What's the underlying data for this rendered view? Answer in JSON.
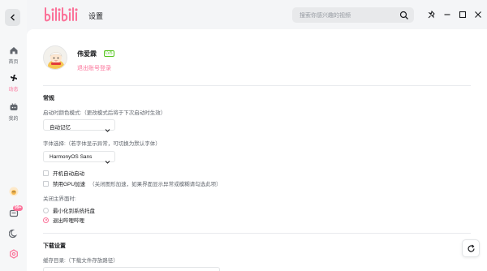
{
  "nav": {
    "home": "首页",
    "dynamic": "动态",
    "mine": "我的",
    "badge": "99+"
  },
  "header": {
    "title": "设置",
    "search_placeholder": "搜索你感兴趣的视频"
  },
  "user": {
    "name": "伟爱霖",
    "level": "LV5",
    "logout": "退出账号登录"
  },
  "general": {
    "title": "常规",
    "color_mode_label": "启动时颜色模式:（更改模式后将于下次启动时生效）",
    "color_mode_value": "自动记忆",
    "font_label": "字体选择:（若字体显示异常，可切换为默认字体）",
    "font_value": "HarmonyOS Sans",
    "autostart": "开机自动启动",
    "gpu_label": "禁用GPU加速",
    "gpu_hint": "（关闭图形加速，如果界面显示异常或模糊请勾选此项）",
    "close_label": "关闭主界面时:",
    "close_options": [
      "最小化到系统托盘",
      "退出哔哩哔哩"
    ]
  },
  "download": {
    "title": "下载设置",
    "cache_label": "缓存目录:（下载文件存放路径）"
  },
  "colors": {
    "accent": "#fb7299",
    "level": "#52c41a"
  },
  "icons": [
    "back-icon",
    "home-icon",
    "dynamic-icon",
    "mine-icon",
    "search-icon",
    "pin-icon",
    "minimize-icon",
    "maximize-icon",
    "close-icon",
    "refresh-icon"
  ]
}
